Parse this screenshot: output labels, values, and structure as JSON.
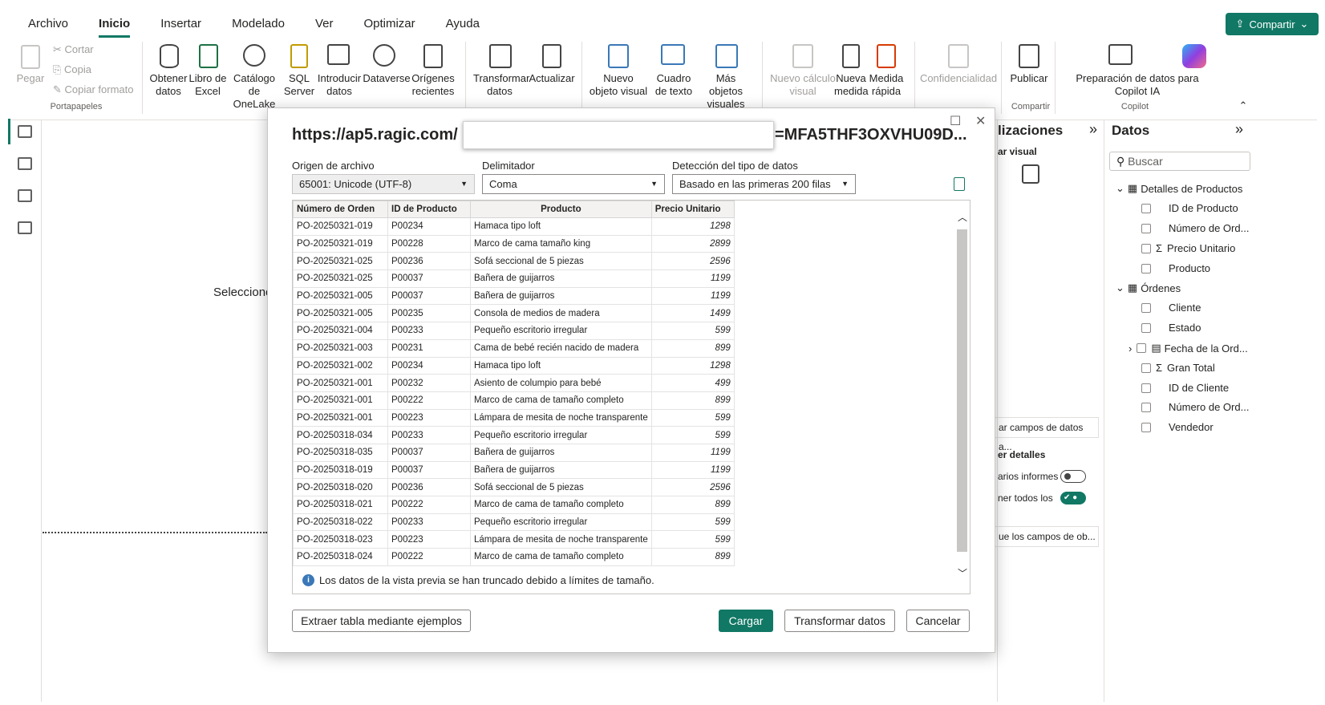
{
  "menu": [
    "Archivo",
    "Inicio",
    "Insertar",
    "Modelado",
    "Ver",
    "Optimizar",
    "Ayuda"
  ],
  "share_label": "Compartir",
  "ribbon": {
    "pegar": "Pegar",
    "cortar": "Cortar",
    "copia": "Copia",
    "copiar_formato": "Copiar formato",
    "portapapeles": "Portapapeles",
    "obtener_datos": "Obtener datos",
    "libro_excel": "Libro de Excel",
    "catalogo": "Catálogo de OneLake",
    "sql": "SQL Server",
    "introducir": "Introducir datos",
    "dataverse": "Dataverse",
    "origenes": "Orígenes recientes",
    "transformar": "Transformar datos",
    "actualizar": "Actualizar",
    "nuevo_visual": "Nuevo objeto visual",
    "cuadro_texto": "Cuadro de texto",
    "mas_visuales": "Más objetos visuales",
    "nuevo_calculo": "Nuevo cálculo visual",
    "nueva_medida": "Nueva medida",
    "medida_rapida": "Medida rápida",
    "confidencialidad": "Confidencialidad",
    "publicar": "Publicar",
    "compartir_grp": "Compartir",
    "preparacion": "Preparación de datos para Copilot IA",
    "copilot_grp": "Copilot"
  },
  "canvas_text": "Seleccione",
  "viz_pane": {
    "title": "lizaciones",
    "sub": "ar visual",
    "campos": "ar campos de datos a...",
    "detalles": "er detalles",
    "varios": "arios informes",
    "todos": "ner todos los",
    "campos_obj": "ue los campos de ob..."
  },
  "data_pane": {
    "title": "Datos",
    "search_placeholder": "Buscar",
    "tables": [
      {
        "name": "Detalles de Productos",
        "fields": [
          "ID de Producto",
          "Número de Ord...",
          "Precio Unitario",
          "Producto"
        ]
      },
      {
        "name": "Órdenes",
        "fields": [
          "Cliente",
          "Estado",
          "Fecha de la Ord...",
          "Gran Total",
          "ID de Cliente",
          "Número de Ord...",
          "Vendedor"
        ]
      }
    ]
  },
  "dialog": {
    "url_prefix": "https://ap5.ragic.com/",
    "url_suffix": "=MFA5THF3OXVHU09D...",
    "origen_label": "Origen de archivo",
    "origen_value": "65001: Unicode (UTF-8)",
    "delim_label": "Delimitador",
    "delim_value": "Coma",
    "det_label": "Detección del tipo de datos",
    "det_value": "Basado en las primeras 200 filas",
    "columns": [
      "Número de Orden",
      "ID de Producto",
      "Producto",
      "Precio Unitario"
    ],
    "rows": [
      [
        "PO-20250321-019",
        "P00234",
        "Hamaca tipo loft",
        "1298"
      ],
      [
        "PO-20250321-019",
        "P00228",
        "Marco de cama tamaño king",
        "2899"
      ],
      [
        "PO-20250321-025",
        "P00236",
        "Sofá seccional de 5 piezas",
        "2596"
      ],
      [
        "PO-20250321-025",
        "P00037",
        "Bañera de guijarros",
        "1199"
      ],
      [
        "PO-20250321-005",
        "P00037",
        "Bañera de guijarros",
        "1199"
      ],
      [
        "PO-20250321-005",
        "P00235",
        "Consola de medios de madera",
        "1499"
      ],
      [
        "PO-20250321-004",
        "P00233",
        "Pequeño escritorio irregular",
        "599"
      ],
      [
        "PO-20250321-003",
        "P00231",
        "Cama de bebé recién nacido de madera",
        "899"
      ],
      [
        "PO-20250321-002",
        "P00234",
        "Hamaca tipo loft",
        "1298"
      ],
      [
        "PO-20250321-001",
        "P00232",
        "Asiento de columpio para bebé",
        "499"
      ],
      [
        "PO-20250321-001",
        "P00222",
        "Marco de cama de tamaño completo",
        "899"
      ],
      [
        "PO-20250321-001",
        "P00223",
        "Lámpara de mesita de noche transparente",
        "599"
      ],
      [
        "PO-20250318-034",
        "P00233",
        "Pequeño escritorio irregular",
        "599"
      ],
      [
        "PO-20250318-035",
        "P00037",
        "Bañera de guijarros",
        "1199"
      ],
      [
        "PO-20250318-019",
        "P00037",
        "Bañera de guijarros",
        "1199"
      ],
      [
        "PO-20250318-020",
        "P00236",
        "Sofá seccional de 5 piezas",
        "2596"
      ],
      [
        "PO-20250318-021",
        "P00222",
        "Marco de cama de tamaño completo",
        "899"
      ],
      [
        "PO-20250318-022",
        "P00233",
        "Pequeño escritorio irregular",
        "599"
      ],
      [
        "PO-20250318-023",
        "P00223",
        "Lámpara de mesita de noche transparente",
        "599"
      ],
      [
        "PO-20250318-024",
        "P00222",
        "Marco de cama de tamaño completo",
        "899"
      ]
    ],
    "note": "Los datos de la vista previa se han truncado debido a límites de tamaño.",
    "btn_extraer": "Extraer tabla mediante ejemplos",
    "btn_cargar": "Cargar",
    "btn_transformar": "Transformar datos",
    "btn_cancelar": "Cancelar"
  }
}
